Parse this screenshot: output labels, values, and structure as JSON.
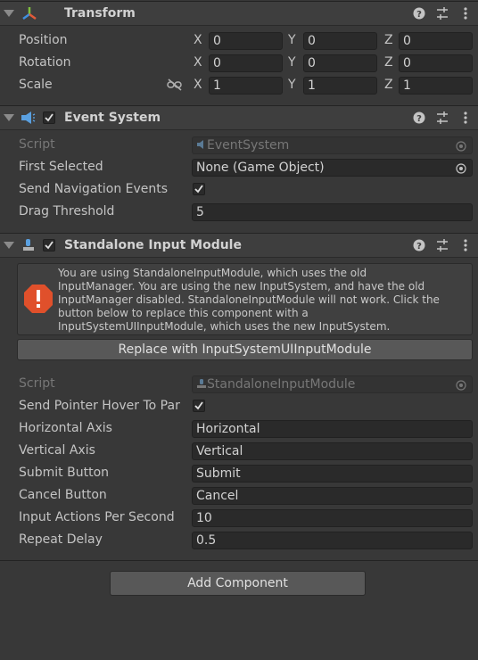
{
  "transform": {
    "title": "Transform",
    "rows": [
      {
        "label": "Position",
        "x": "0",
        "y": "0",
        "z": "0"
      },
      {
        "label": "Rotation",
        "x": "0",
        "y": "0",
        "z": "0"
      },
      {
        "label": "Scale",
        "x": "1",
        "y": "1",
        "z": "1"
      }
    ],
    "axes": {
      "x": "X",
      "y": "Y",
      "z": "Z"
    }
  },
  "event_system": {
    "title": "Event System",
    "enabled": true,
    "script_label": "Script",
    "script_value": "EventSystem",
    "first_selected_label": "First Selected",
    "first_selected_value": "None (Game Object)",
    "send_nav_label": "Send Navigation Events",
    "send_nav_checked": true,
    "drag_threshold_label": "Drag Threshold",
    "drag_threshold_value": "5"
  },
  "standalone": {
    "title": "Standalone Input Module",
    "enabled": true,
    "help_lines": [
      "You are using StandaloneInputModule, which uses the old",
      "InputManager. You are using the new InputSystem, and have the old",
      "InputManager disabled. StandaloneInputModule will not work. Click the",
      "button below to replace this component with a",
      "InputSystemUIInputModule, which uses the new InputSystem."
    ],
    "replace_button": "Replace with InputSystemUIInputModule",
    "script_label": "Script",
    "script_value": "StandaloneInputModule",
    "send_pointer_label": "Send Pointer Hover To Par",
    "send_pointer_checked": true,
    "horizontal_label": "Horizontal Axis",
    "horizontal_value": "Horizontal",
    "vertical_label": "Vertical Axis",
    "vertical_value": "Vertical",
    "submit_label": "Submit Button",
    "submit_value": "Submit",
    "cancel_label": "Cancel Button",
    "cancel_value": "Cancel",
    "ips_label": "Input Actions Per Second",
    "ips_value": "10",
    "repeat_label": "Repeat Delay",
    "repeat_value": "0.5"
  },
  "add_component": "Add Component",
  "colors": {
    "background": "#383838",
    "header": "#3e3e3e",
    "field": "#2a2a2a",
    "warning": "#e0502b"
  }
}
